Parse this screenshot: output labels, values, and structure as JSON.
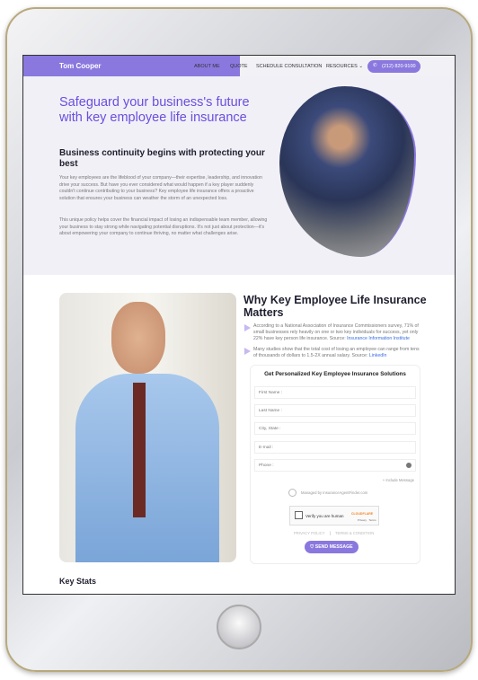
{
  "nav": {
    "brand": "Tom Cooper",
    "items": [
      "ABOUT ME",
      "QUOTE",
      "SCHEDULE CONSULTATION",
      "RESOURCES"
    ],
    "phone": "(212) 820-9100",
    "accent": "#8a78df"
  },
  "hero": {
    "title": "Safeguard your business's future with key employee life insurance",
    "subtitle": "Business continuity begins with protecting your best",
    "p1": "Your key employees are the lifeblood of your company—their expertise, leadership, and innovation drive your success. But have you ever considered what would happen if a key player suddenly couldn't continue contributing to your business? Key employee life insurance offers a proactive solution that ensures your business can weather the storm of an unexpected loss.",
    "p2": "This unique policy helps cover the financial impact of losing an indispensable team member, allowing your business to stay strong while navigating potential disruptions. It's not just about protection—it's about empowering your company to continue thriving, no matter what challenges arise."
  },
  "why": {
    "title": "Why Key Employee Life Insurance Matters",
    "b1": "According to a National Association of Insurance Commissioners survey, 71% of small businesses rely heavily on one or two key individuals for success, yet only 22% have key person life insurance. Source: ",
    "b1_link": "Insurance Information Institute",
    "b2": "Many studies show that the total cost of losing an employee can range from tens of thousands of dollars to 1.5-2X annual salary. Source: ",
    "b2_link": "LinkedIn"
  },
  "form": {
    "title": "Get Personalized Key Employee Insurance Solutions",
    "fields": [
      "First Name :",
      "Last Name :",
      "City, State :",
      "E-mail :",
      "Phone :"
    ],
    "include": "+ Include Message",
    "managed": "Managed by InsuranceAgentFinder.com",
    "captcha": "Verify you are human",
    "captcha_brand": "CLOUDFLARE",
    "captcha_sub": "Privacy · Terms",
    "privacy": "PRIVACY POLICY",
    "sep": "|",
    "terms": "TERMS & CONDITION",
    "send": "SEND MESSAGE"
  },
  "stats": {
    "title": "Key Stats"
  }
}
